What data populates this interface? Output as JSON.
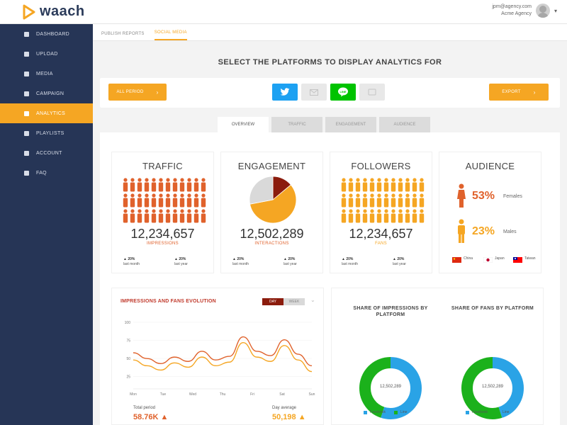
{
  "app": {
    "name": "waach",
    "brand_color": "#f5a623",
    "navy": "#263556"
  },
  "user": {
    "email": "jpm@agency.com",
    "company": "Acme Agency"
  },
  "sidebar": {
    "items": [
      {
        "label": "DASHBOARD",
        "icon": "dashboard-icon",
        "active": false
      },
      {
        "label": "UPLOAD",
        "icon": "upload-icon",
        "active": false
      },
      {
        "label": "MEDIA",
        "icon": "media-icon",
        "active": false
      },
      {
        "label": "CAMPAIGN",
        "icon": "campaign-icon",
        "active": false
      },
      {
        "label": "ANALYTICS",
        "icon": "analytics-icon",
        "active": true
      },
      {
        "label": "PLAYLISTS",
        "icon": "playlists-icon",
        "active": false
      },
      {
        "label": "ACCOUNT",
        "icon": "account-icon",
        "active": false
      },
      {
        "label": "FAQ",
        "icon": "faq-icon",
        "active": false
      }
    ]
  },
  "subtabs": [
    {
      "label": "PUBLISH REPORTS",
      "active": false
    },
    {
      "label": "SOCIAL MEDIA",
      "active": true
    }
  ],
  "heading": "SELECT THE PLATFORMS TO DISPLAY ANALYTICS FOR",
  "platform_bar": {
    "left_button": "ALL PERIOD",
    "right_button": "EXPORT",
    "platforms": [
      {
        "name": "twitter-icon",
        "color": "#1da1f2",
        "enabled": true
      },
      {
        "name": "email-icon",
        "color": "#e6e6e6",
        "enabled": false
      },
      {
        "name": "line-icon",
        "color": "#00c300",
        "enabled": true
      },
      {
        "name": "message-icon",
        "color": "#e6e6e6",
        "enabled": false
      }
    ]
  },
  "tabs": [
    {
      "label": "OVERVIEW",
      "active": true
    },
    {
      "label": "TRAFFIC",
      "active": false
    },
    {
      "label": "ENGAGEMENT",
      "active": false
    },
    {
      "label": "AUDIENCE",
      "active": false
    }
  ],
  "stats": {
    "traffic": {
      "title": "TRAFFIC",
      "value": "12,234,657",
      "sub": "IMPRESSIONS",
      "left_delta": "▲ 20%",
      "left_caption": "last month",
      "right_delta": "▲ 20%",
      "right_caption": "last year",
      "color": "#e0622c"
    },
    "engagement": {
      "title": "ENGAGEMENT",
      "value": "12,502,289",
      "sub": "INTERACTIONS",
      "left_delta": "▲ 20%",
      "left_caption": "last month",
      "right_delta": "▲ 20%",
      "right_caption": "last year",
      "pie": [
        {
          "name": "a",
          "value": 0.14,
          "color": "#8b1c0d"
        },
        {
          "name": "b",
          "value": 0.58,
          "color": "#f5a623"
        },
        {
          "name": "c",
          "value": 0.28,
          "color": "#d9d9d9"
        }
      ]
    },
    "followers": {
      "title": "FOLLOWERS",
      "value": "12,234,657",
      "sub": "FANS",
      "left_delta": "▲ 20%",
      "left_caption": "last month",
      "right_delta": "▲ 20%",
      "right_caption": "last year",
      "color": "#f5a623"
    },
    "audience": {
      "title": "AUDIENCE",
      "female_pct": "53%",
      "female_label": "Females",
      "male_pct": "23%",
      "male_label": "Males",
      "flags": [
        {
          "label": "China",
          "color": "#de2910"
        },
        {
          "label": "Japan",
          "color": "#ffffff"
        },
        {
          "label": "Taiwan",
          "color": "#fe0000"
        }
      ]
    }
  },
  "evolution_chart": {
    "title": "IMPRESSIONS AND FANS EVOLUTION",
    "toggle_left": "DAY",
    "toggle_right": "WEEK",
    "left_kpi_label": "Total period",
    "left_kpi_value": "58.76K ▲",
    "right_kpi_label": "Day average",
    "right_kpi_value": "50,198 ▲",
    "chart_data": {
      "type": "line",
      "x": [
        "Mon",
        "Tue",
        "Wed",
        "Thu",
        "Fri",
        "Sat",
        "Sun"
      ],
      "ylim": [
        0,
        100
      ],
      "y_ticks": [
        "100",
        "75",
        "50",
        "25"
      ],
      "series": [
        {
          "values": [
            50,
            42,
            35,
            44,
            38,
            52,
            40,
            45,
            72,
            52,
            46,
            68,
            48,
            32
          ],
          "color": "#e0622c"
        },
        {
          "values": [
            40,
            32,
            26,
            36,
            30,
            44,
            32,
            37,
            64,
            44,
            38,
            60,
            40,
            24
          ],
          "color": "#f5a623"
        }
      ]
    }
  },
  "donuts": [
    {
      "title": "SHARE OF IMPRESSIONS BY PLATFORM",
      "center": "12,502,289",
      "chart_data": {
        "type": "pie",
        "labels": [
          "Facebook",
          "Line"
        ],
        "values": [
          0.55,
          0.45
        ],
        "colors": [
          "#2aa3e6",
          "#1bb11b"
        ]
      }
    },
    {
      "title": "SHARE OF FANS BY PLATFORM",
      "center": "12,502,289",
      "chart_data": {
        "type": "pie",
        "labels": [
          "Facebook",
          "Line"
        ],
        "values": [
          0.45,
          0.55
        ],
        "colors": [
          "#2aa3e6",
          "#1bb11b"
        ]
      }
    }
  ]
}
